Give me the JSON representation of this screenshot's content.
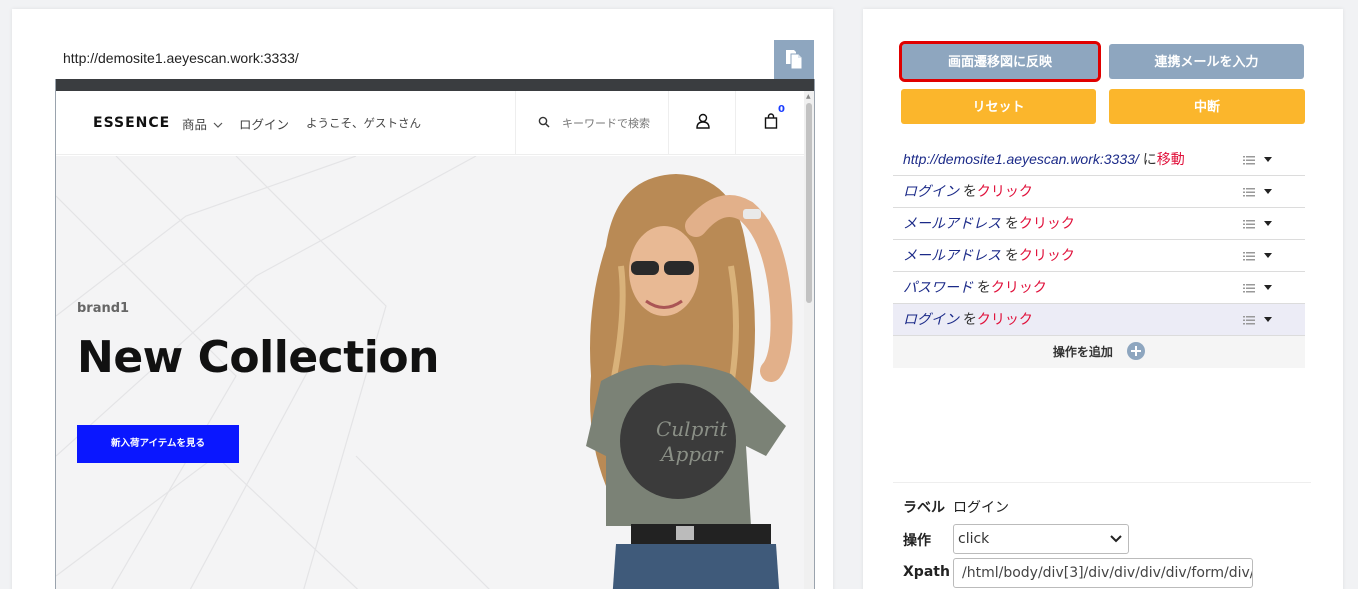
{
  "recorder": {
    "url": "http://demosite1.aeyescan.work:3333/",
    "copy_icon": "copy-icon"
  },
  "site": {
    "logo": "ESSENCE",
    "nav": [
      "商品",
      "ログイン",
      "ようこそ、ゲストさん"
    ],
    "search_placeholder": "キーワードで検索",
    "cart_count": "0",
    "brand": "brand1",
    "hero_title": "New Collection",
    "hero_button": "新入荷アイテムを見る",
    "accent_color": "#0a17ff"
  },
  "actions": {
    "reflect": "画面遷移図に反映",
    "mail": "連携メールを入力",
    "reset": "リセット",
    "abort": "中断"
  },
  "operations": [
    {
      "target": "http://demosite1.aeyescan.work:3333/",
      "mid": " に",
      "action": "移動"
    },
    {
      "target": "ログイン",
      "mid": " を",
      "action": "クリック"
    },
    {
      "target": "メールアドレス",
      "mid": " を",
      "action": "クリック"
    },
    {
      "target": "メールアドレス",
      "mid": " を",
      "action": "クリック"
    },
    {
      "target": "パスワード",
      "mid": " を",
      "action": "クリック"
    },
    {
      "target": "ログイン",
      "mid": " を",
      "action": "クリック"
    }
  ],
  "add_operation": "操作を追加",
  "detail": {
    "label_caption": "ラベル",
    "label_value": "ログイン",
    "op_caption": "操作",
    "op_value": "click",
    "xpath_caption": "Xpath",
    "xpath_value": "/html/body/div[3]/div/div/div/div/form/div/"
  }
}
